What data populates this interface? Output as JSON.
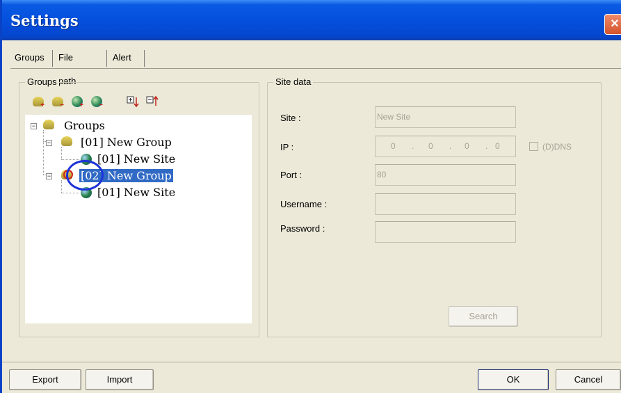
{
  "window": {
    "title": "Settings",
    "close_label": "×"
  },
  "tabs": [
    {
      "label": "Groups"
    },
    {
      "label": "File path"
    },
    {
      "label": "Alert"
    }
  ],
  "groups_panel": {
    "legend": "Groups",
    "toolbar_icons": [
      "add-group-icon",
      "remove-group-icon",
      "add-site-icon",
      "remove-site-icon",
      "expand-all-icon",
      "collapse-all-icon"
    ],
    "tree": {
      "root": "Groups",
      "groups": [
        {
          "label": "[01] New Group",
          "sites": [
            "[01] New Site"
          ]
        },
        {
          "label": "[02] New Group",
          "sites": [
            "[01] New Site"
          ],
          "selected": true
        }
      ]
    }
  },
  "site_data": {
    "legend": "Site data",
    "site_label": "Site :",
    "site_value": "New Site",
    "ip_label": "IP :",
    "ip_octets": [
      "0",
      "0",
      "0",
      "0"
    ],
    "ddns_label": "(D)DNS",
    "port_label": "Port :",
    "port_value": "80",
    "username_label": "Username :",
    "username_value": "",
    "password_label": "Password :",
    "password_value": "",
    "search_label": "Search"
  },
  "footer": {
    "export_label": "Export",
    "import_label": "Import",
    "ok_label": "OK",
    "cancel_label": "Cancel"
  },
  "colors": {
    "titlebar": "#0450dd",
    "selection": "#316ac5",
    "annotation_circle": "#1d33d8"
  }
}
